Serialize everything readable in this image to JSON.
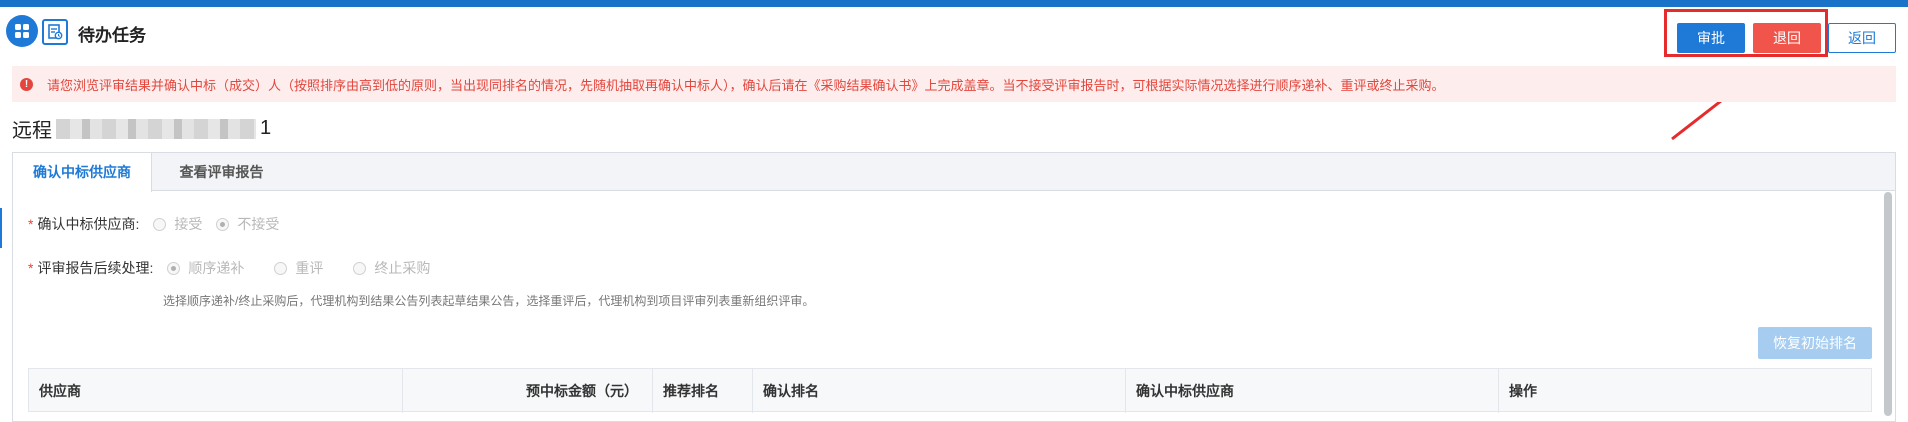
{
  "header": {
    "title": "待办任务",
    "buttons": {
      "approve": "审批",
      "retreat": "退回",
      "back": "返回"
    }
  },
  "alert": {
    "text": "请您浏览评审结果并确认中标（成交）人（按照排序由高到低的原则，当出现同排名的情况，先随机抽取再确认中标人），确认后请在《采购结果确认书》上完成盖章。当不接受评审报告时，可根据实际情况选择进行顺序递补、重评或终止采购。"
  },
  "project": {
    "name_prefix": "远程",
    "name_suffix": "1"
  },
  "tabs": [
    {
      "label": "确认中标供应商",
      "active": true
    },
    {
      "label": "查看评审报告",
      "active": false
    }
  ],
  "form": {
    "confirm_supplier": {
      "label": "确认中标供应商:",
      "options": [
        {
          "label": "接受",
          "selected": false
        },
        {
          "label": "不接受",
          "selected": true
        }
      ]
    },
    "report_followup": {
      "label": "评审报告后续处理:",
      "options": [
        {
          "label": "顺序递补",
          "selected": true
        },
        {
          "label": "重评",
          "selected": false
        },
        {
          "label": "终止采购",
          "selected": false
        }
      ]
    },
    "hint": "选择顺序递补/终止采购后，代理机构到结果公告列表起草结果公告，选择重评后，代理机构到项目评审列表重新组织评审。"
  },
  "restore_button": "恢复初始排名",
  "table": {
    "columns": [
      "供应商",
      "预中标金额（元）",
      "推荐排名",
      "确认排名",
      "确认中标供应商",
      "操作"
    ]
  },
  "colors": {
    "primary": "#1e7ad6",
    "danger": "#f0544a",
    "alert_text": "#e4463d",
    "alert_bg": "#fdeeed"
  }
}
